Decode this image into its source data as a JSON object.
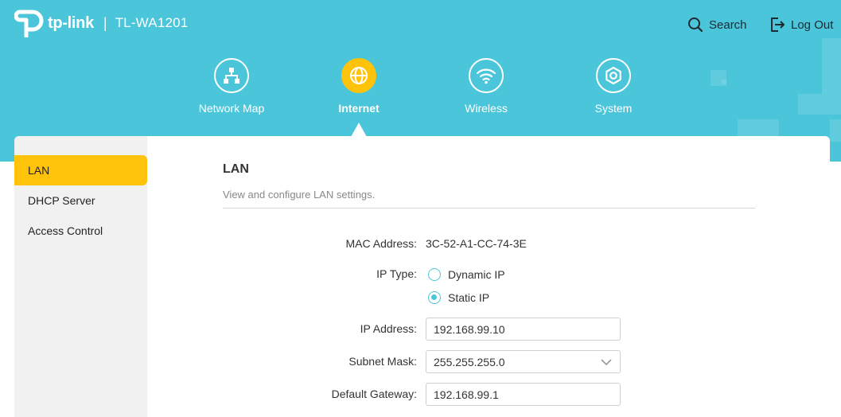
{
  "header": {
    "brand": "tp-link",
    "separator": "|",
    "model": "TL-WA1201",
    "search_label": "Search",
    "logout_label": "Log Out"
  },
  "nav": [
    {
      "label": "Network Map",
      "icon": "network-map-icon",
      "active": false
    },
    {
      "label": "Internet",
      "icon": "globe-icon",
      "active": true
    },
    {
      "label": "Wireless",
      "icon": "wifi-icon",
      "active": false
    },
    {
      "label": "System",
      "icon": "gear-icon",
      "active": false
    }
  ],
  "sidebar": {
    "items": [
      {
        "label": "LAN",
        "active": true
      },
      {
        "label": "DHCP Server",
        "active": false
      },
      {
        "label": "Access Control",
        "active": false
      }
    ]
  },
  "main": {
    "title": "LAN",
    "subtitle": "View and configure LAN settings.",
    "mac_label": "MAC Address:",
    "mac_value": "3C-52-A1-CC-74-3E",
    "ip_type_label": "IP Type:",
    "ip_type_options": [
      "Dynamic IP",
      "Static IP"
    ],
    "ip_type_selected": "Static IP",
    "ip_label": "IP Address:",
    "ip_value": "192.168.99.10",
    "subnet_label": "Subnet Mask:",
    "subnet_value": "255.255.255.0",
    "gateway_label": "Default Gateway:",
    "gateway_value": "192.168.99.1"
  },
  "colors": {
    "header_bg": "#4ac5d9",
    "accent": "#ffc30b",
    "sidebar_bg": "#f1f1f1",
    "radio": "#4ac5d9"
  }
}
